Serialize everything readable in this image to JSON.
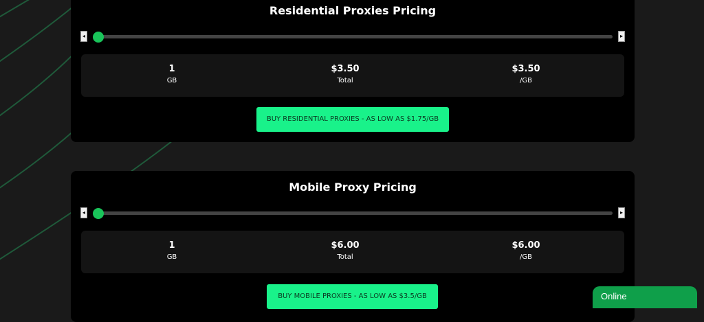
{
  "residential": {
    "title": "Residential Proxies Pricing",
    "slider_value_gb": 1,
    "stats": [
      {
        "value": "1",
        "label": "GB"
      },
      {
        "value": "$3.50",
        "label": "Total"
      },
      {
        "value": "$3.50",
        "label": "/GB"
      }
    ],
    "button_label": "BUY RESIDENTIAL PROXIES - AS LOW AS $1.75/GB"
  },
  "mobile": {
    "title": "Mobile Proxy Pricing",
    "slider_value_gb": 1,
    "stats": [
      {
        "value": "1",
        "label": "GB"
      },
      {
        "value": "$6.00",
        "label": "Total"
      },
      {
        "value": "$6.00",
        "label": "/GB"
      }
    ],
    "button_label": "BUY MOBILE PROXIES - AS LOW AS $3.5/GB"
  },
  "chat": {
    "status": "Online"
  },
  "colors": {
    "accent": "#19f28a",
    "slider_thumb": "#19c45a",
    "card_bg": "#000000",
    "page_bg": "#1a1a1a",
    "online_bg": "#0f9f4a"
  },
  "icons": {
    "slider_left": "arrow-left-icon",
    "slider_right": "arrow-right-icon"
  }
}
